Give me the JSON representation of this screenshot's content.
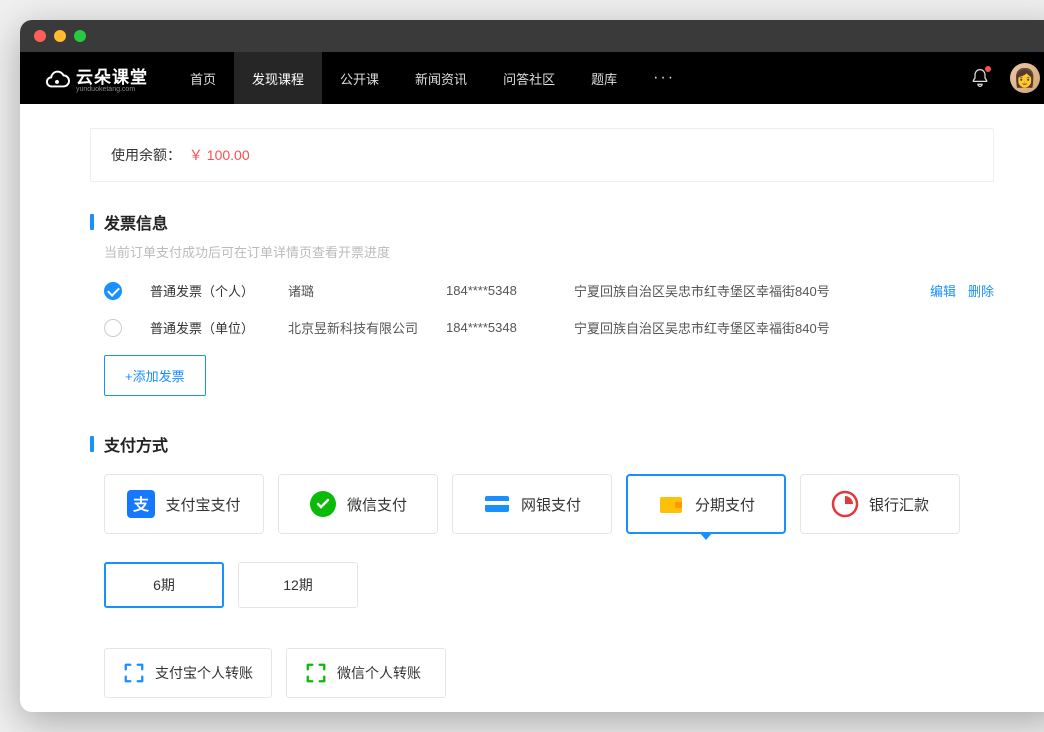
{
  "brand": {
    "name": "云朵课堂",
    "sub": "yunduoketang.com"
  },
  "nav": {
    "items": [
      "首页",
      "发现课程",
      "公开课",
      "新闻资讯",
      "问答社区",
      "题库"
    ],
    "active_index": 1
  },
  "balance": {
    "label": "使用余额：",
    "value": "￥ 100.00"
  },
  "invoice": {
    "title": "发票信息",
    "subtitle": "当前订单支付成功后可在订单详情页查看开票进度",
    "rows": [
      {
        "type": "普通发票（个人）",
        "name": "诸璐",
        "phone": "184****5348",
        "addr": "宁夏回族自治区吴忠市红寺堡区幸福街840号",
        "selected": true,
        "edit": "编辑",
        "delete": "删除"
      },
      {
        "type": "普通发票（单位）",
        "name": "北京昱新科技有限公司",
        "phone": "184****5348",
        "addr": "宁夏回族自治区吴忠市红寺堡区幸福街840号",
        "selected": false
      }
    ],
    "add_btn": "+添加发票"
  },
  "payment": {
    "title": "支付方式",
    "options": [
      "支付宝支付",
      "微信支付",
      "网银支付",
      "分期支付",
      "银行汇款"
    ],
    "selected_index": 3,
    "periods": [
      "6期",
      "12期"
    ],
    "period_selected": 0,
    "transfers": [
      "支付宝个人转账",
      "微信个人转账"
    ]
  }
}
